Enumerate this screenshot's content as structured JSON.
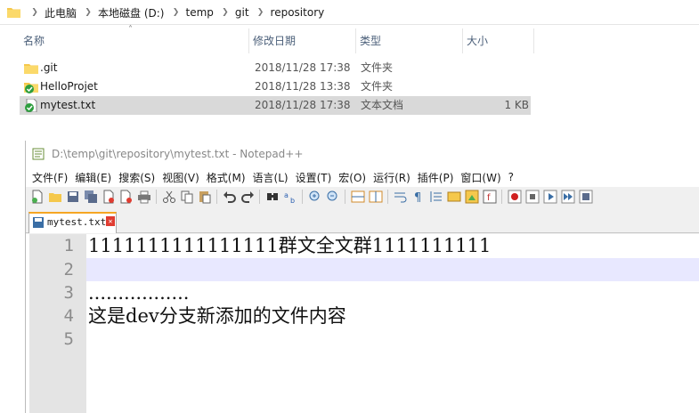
{
  "explorer": {
    "breadcrumb": [
      "此电脑",
      "本地磁盘 (D:)",
      "temp",
      "git",
      "repository"
    ],
    "columns": {
      "name": "名称",
      "date": "修改日期",
      "type": "类型",
      "size": "大小"
    },
    "files": [
      {
        "name": ".git",
        "date": "2018/11/28 17:38",
        "type": "文件夹",
        "size": "",
        "icon": "folder-icon"
      },
      {
        "name": "HelloProjet",
        "date": "2018/11/28 13:38",
        "type": "文件夹",
        "size": "",
        "icon": "git-folder-icon"
      },
      {
        "name": "mytest.txt",
        "date": "2018/11/28 17:38",
        "type": "文本文档",
        "size": "1 KB",
        "icon": "git-file-icon"
      }
    ]
  },
  "notepad": {
    "title": "D:\\temp\\git\\repository\\mytest.txt - Notepad++",
    "menu": [
      "文件(F)",
      "编辑(E)",
      "搜索(S)",
      "视图(V)",
      "格式(M)",
      "语言(L)",
      "设置(T)",
      "宏(O)",
      "运行(R)",
      "插件(P)",
      "窗口(W)",
      "?"
    ],
    "tab": "mytest.txt",
    "lines": [
      {
        "num": "1",
        "text": "1111111111111111群文全文群1111111111"
      },
      {
        "num": "2",
        "text": ""
      },
      {
        "num": "3",
        "text": "................."
      },
      {
        "num": "4",
        "text": "这是dev分支新添加的文件内容"
      },
      {
        "num": "5",
        "text": ""
      }
    ]
  },
  "colors": {
    "accent": "#f5a623",
    "selection": "#d9d9d9",
    "current_line": "#e8e8ff"
  }
}
